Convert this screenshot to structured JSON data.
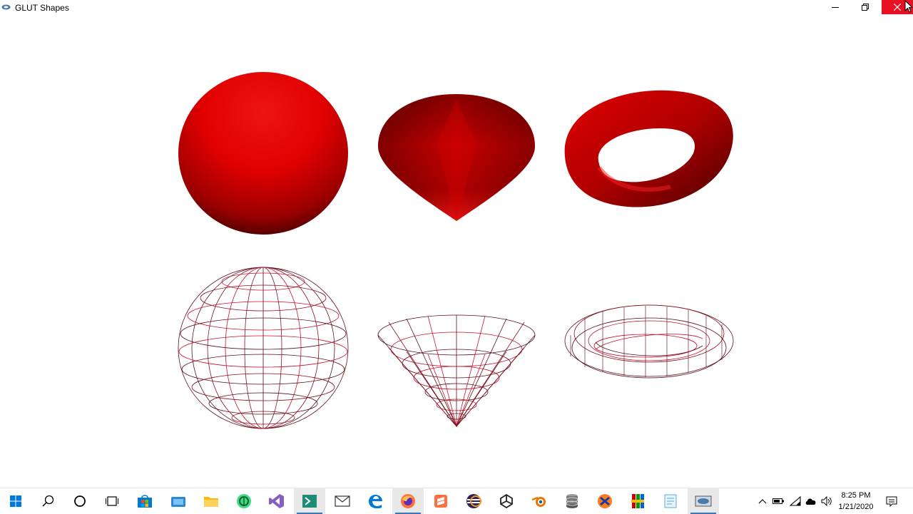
{
  "window": {
    "title": "GLUT Shapes",
    "controls": [
      "minimize-icon",
      "restore-icon",
      "close-icon"
    ]
  },
  "scene": {
    "object_color": "#e00000",
    "wire_color": "#c8102e",
    "solid_row": [
      "sphere",
      "cone",
      "torus"
    ],
    "wire_row": [
      "sphere",
      "cone",
      "torus"
    ]
  },
  "taskbar": {
    "pinned": [
      "start-icon",
      "search-icon",
      "cortana-icon",
      "task-view-icon",
      "store-icon",
      "folder-app-icon",
      "file-explorer-icon",
      "android-studio-icon",
      "visual-studio-icon",
      "powershell-icon",
      "mail-icon",
      "edge-icon",
      "firefox-icon",
      "sublime-icon",
      "eclipse-icon",
      "unity-icon",
      "blender-icon",
      "database-icon",
      "xampp-icon",
      "winrar-icon",
      "notepad-icon",
      "glut-app-icon"
    ],
    "tray": [
      "chevron-up-icon",
      "battery-icon",
      "wifi-icon",
      "cloud-icon",
      "volume-icon"
    ],
    "time": "8:25 PM",
    "date": "1/21/2020"
  }
}
